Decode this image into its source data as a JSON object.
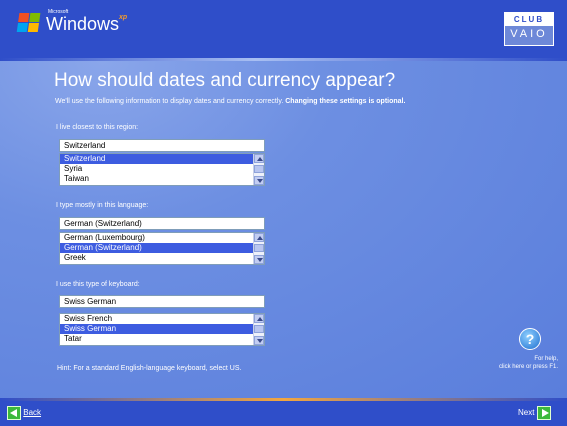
{
  "header": {
    "brand_small": "Microsoft",
    "brand": "Windows",
    "brand_suffix": "xp",
    "club_top": "CLUB",
    "club_bottom": "VAIO",
    "flag_colors": [
      "#f25022",
      "#7fba00",
      "#00a4ef",
      "#ffb900"
    ]
  },
  "main": {
    "title": "How should dates and currency appear?",
    "intro_plain": "We'll use the following information to display dates and currency correctly. ",
    "intro_bold": "Changing these settings is optional.",
    "region": {
      "label": "I live closest to this region:",
      "value": "Switzerland",
      "options": [
        "Switzerland",
        "Syria",
        "Taiwan"
      ],
      "selected_index": 0
    },
    "language": {
      "label": "I type mostly in this language:",
      "value": "German (Switzerland)",
      "options": [
        "German (Luxembourg)",
        "German (Switzerland)",
        "Greek"
      ],
      "selected_index": 1
    },
    "keyboard": {
      "label": "I use this type of keyboard:",
      "value": "Swiss German",
      "options": [
        "Swiss French",
        "Swiss German",
        "Tatar"
      ],
      "selected_index": 1
    },
    "hint": "Hint: For a standard English-language keyboard, select US.",
    "help_line1": "For help,",
    "help_line2": "click here or press F1."
  },
  "footer": {
    "back_label": "Back",
    "next_label": "Next"
  },
  "colors": {
    "background": "#5a7edc",
    "bar": "#2f4ec9",
    "selection": "#3d5ce0",
    "nav_arrow": "#3cb93c"
  },
  "icons": [
    "windows-flag-icon",
    "help-question-icon",
    "back-arrow-icon",
    "next-arrow-icon",
    "scroll-up-icon",
    "scroll-down-icon"
  ]
}
